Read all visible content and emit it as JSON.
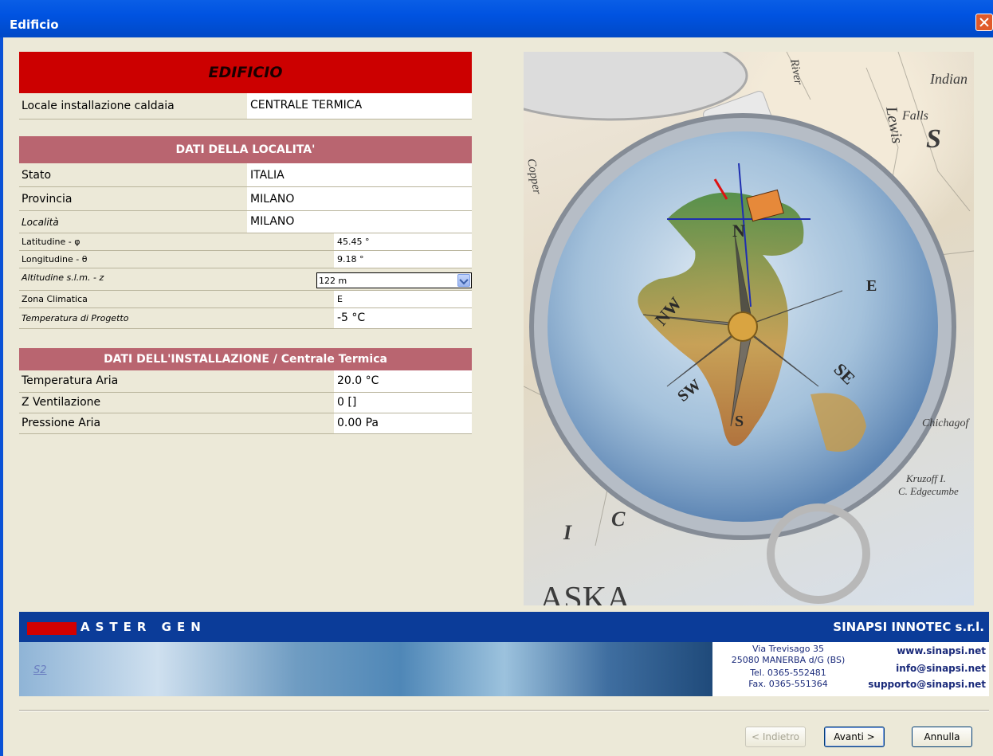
{
  "window": {
    "title": "Edificio"
  },
  "edificio": {
    "header": "EDIFICIO",
    "locale_label": "Locale installazione caldaia",
    "locale_value": "CENTRALE TERMICA"
  },
  "localita": {
    "header": "DATI DELLA LOCALITA'",
    "rows": [
      {
        "label": "Stato",
        "value": "ITALIA"
      },
      {
        "label": "Provincia",
        "value": "MILANO"
      },
      {
        "label": "Località",
        "value": "MILANO"
      },
      {
        "label": "Latitudine - φ",
        "value": "45.45 °"
      },
      {
        "label": "Longitudine - θ",
        "value": "9.18 °"
      },
      {
        "label": "Altitudine s.l.m. - z",
        "value": "122 m"
      },
      {
        "label": "Zona Climatica",
        "value": "E"
      },
      {
        "label": "Temperatura di Progetto",
        "value": "-5 °C"
      }
    ]
  },
  "installazione": {
    "header": "DATI DELL'INSTALLAZIONE / Centrale Termica",
    "rows": [
      {
        "label": "Temperatura Aria",
        "value": "20.0 °C"
      },
      {
        "label": "Z Ventilazione",
        "value": "0 []"
      },
      {
        "label": "Pressione Aria",
        "value": "0.00 Pa"
      }
    ]
  },
  "banner": {
    "product": "ASTER GEN",
    "company": "SINAPSI INNOTEC s.r.l.",
    "address1": "Via Trevisago 35",
    "address2": "25080 MANERBA d/G (BS)",
    "tel": "Tel. 0365-552481",
    "fax": "Fax. 0365-551364",
    "web": "www.sinapsi.net",
    "info": "info@sinapsi.net",
    "support": "supporto@sinapsi.net",
    "logo_text": "S2"
  },
  "picture": {
    "map_labels": [
      "Indian",
      "Falls",
      "S",
      "Lewis",
      "River",
      "Indian",
      "Copper",
      "C",
      "I",
      "C",
      "ASKA.",
      "Kruzoff I.",
      "C. Edgecumbe",
      "Chichagof"
    ],
    "compass_labels": [
      "N",
      "S",
      "E",
      "SE",
      "SW",
      "NW"
    ]
  },
  "buttons": {
    "back": "< Indietro",
    "next": "Avanti >",
    "cancel": "Annulla"
  }
}
